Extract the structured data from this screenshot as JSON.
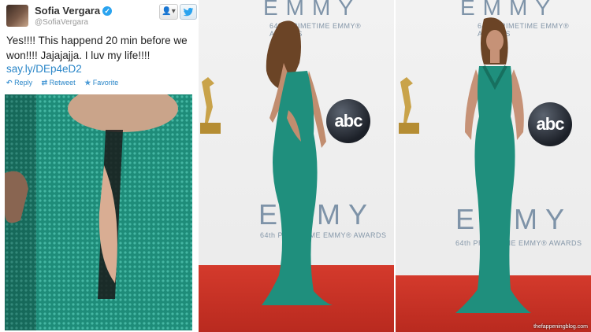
{
  "tweet": {
    "name": "Sofia Vergara",
    "handle": "@SofiaVergara",
    "text": "Yes!!!! This happend 20 min before we won!!!! Jajajajja. I luv my life!!!!",
    "link": "say.ly/DEp4eD2",
    "actions": {
      "reply": "Reply",
      "retweet": "Retweet",
      "favorite": "Favorite"
    },
    "follow_icon": "person-icon",
    "bird_icon": "twitter-bird-icon"
  },
  "backdrop": {
    "word": "EMMY",
    "subtitle": "64th PRIMETIME EMMY® AWARDS",
    "network": "abc"
  },
  "watermark": "thefappeningblog.com",
  "colors": {
    "dress": "#1f8f7d",
    "carpet": "#c8322a",
    "link": "#2a86c8",
    "backdrop_text": "#7e93a8"
  }
}
